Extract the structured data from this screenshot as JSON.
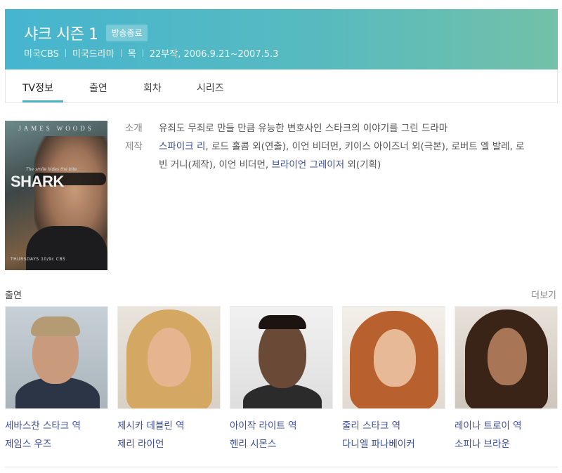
{
  "header": {
    "title": "샤크 시즌 1",
    "status": "방송종료",
    "meta": [
      "미국CBS",
      "미국드라마",
      "목",
      "22부작, 2006.9.21~2007.5.3"
    ]
  },
  "tabs": [
    "TV정보",
    "출연",
    "회차",
    "시리즈"
  ],
  "poster": {
    "top_text": "JAMES WOODS",
    "tagline": "The smile hides the bite.",
    "logo": "SHARK",
    "bottom_text": "THURSDAYS 10/9c CBS"
  },
  "info": {
    "intro_label": "소개",
    "intro_text": "유죄도 무죄로 만들 만큼 유능한 변호사인 스타크의 이야기를 그린 드라마",
    "production_label": "제작",
    "production": {
      "director_link": "스파이크 리",
      "part1": ", 로드 홀콤 외(연출), 이언 비더먼, 키이스 아이즈너 외(극본), 로버트 엘 발레, 로빈 거니(제작), 이언 비더먼, ",
      "producer_link": "브라이언 그레이저",
      "part2": " 외(기획)"
    }
  },
  "cast_section": {
    "title": "출연",
    "more": "더보기",
    "members": [
      {
        "role": "세바스찬 스타크 역",
        "name": "제임스 우즈"
      },
      {
        "role": "제시카 데블린 역",
        "name": "제리 라이언"
      },
      {
        "role": "아이작 라이트 역",
        "name": "헨리 시몬스"
      },
      {
        "role": "줄리 스타크 역",
        "name": "다니엘 파나베이커"
      },
      {
        "role": "레이나 트로이 역",
        "name": "소피나 브라운"
      }
    ]
  },
  "colors": {
    "header_start": "#46b5cf",
    "header_end": "#72c1a8",
    "link": "#3b4d9d",
    "tab_active": "#4fb3c3"
  }
}
